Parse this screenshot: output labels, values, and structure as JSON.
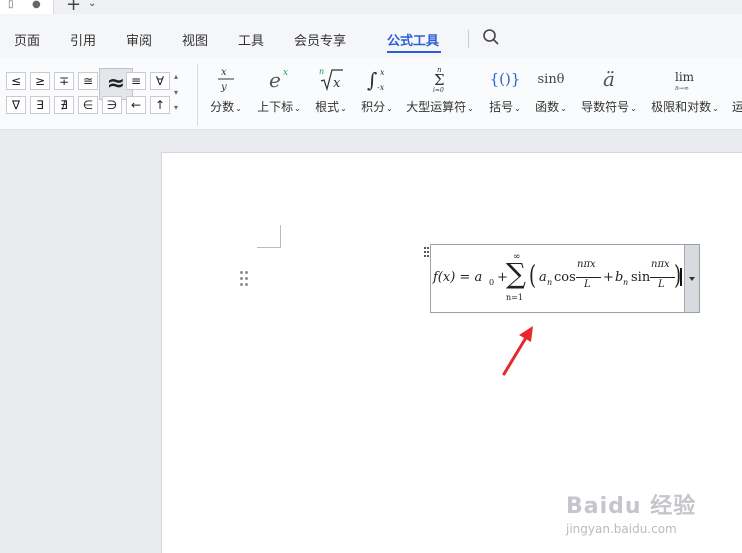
{
  "tabs": {
    "new_tab": "+"
  },
  "menu": {
    "items": [
      "页面",
      "引用",
      "审阅",
      "视图",
      "工具",
      "会员专享",
      "公式工具"
    ],
    "active": "公式工具"
  },
  "symbols": {
    "row1": [
      "≤",
      "≥",
      "∓",
      "≅",
      "≈",
      "≡",
      "∀"
    ],
    "row2": [
      "∇",
      "∃",
      "∄",
      "∈",
      "∋",
      "←",
      "↑"
    ],
    "selected": "≈"
  },
  "tools": [
    {
      "label": "分数",
      "icon_text": "x/y"
    },
    {
      "label": "上下标",
      "icon_text": "e^x"
    },
    {
      "label": "根式",
      "icon_text": "ⁿ√x"
    },
    {
      "label": "积分",
      "icon_text": "∫"
    },
    {
      "label": "大型运算符",
      "icon_text": "Σ"
    },
    {
      "label": "括号",
      "icon_text": "{()}"
    },
    {
      "label": "函数",
      "icon_text": "sinθ"
    },
    {
      "label": "导数符号",
      "icon_text": "ä"
    },
    {
      "label": "极限和对数",
      "icon_text": "lim"
    },
    {
      "label": "运"
    }
  ],
  "formula": {
    "lhs": "f(x) = a",
    "a_sub": "0",
    "plus1": "+",
    "sum_top": "∞",
    "sum_sym": "∑",
    "sum_bottom": "n=1",
    "lparen": "(",
    "a_n": "a",
    "n_sub1": "n",
    "cos": "cos",
    "frac_num": "nπx",
    "frac_den": "L",
    "plus2": "+",
    "b_n": "b",
    "n_sub2": "n",
    "sin": "sin",
    "rparen": ")"
  },
  "watermark": {
    "line1": "Baidu 经验",
    "line2": "jingyan.baidu.com"
  },
  "colors": {
    "accent": "#2b5fd9",
    "arrow": "#e8262b"
  }
}
